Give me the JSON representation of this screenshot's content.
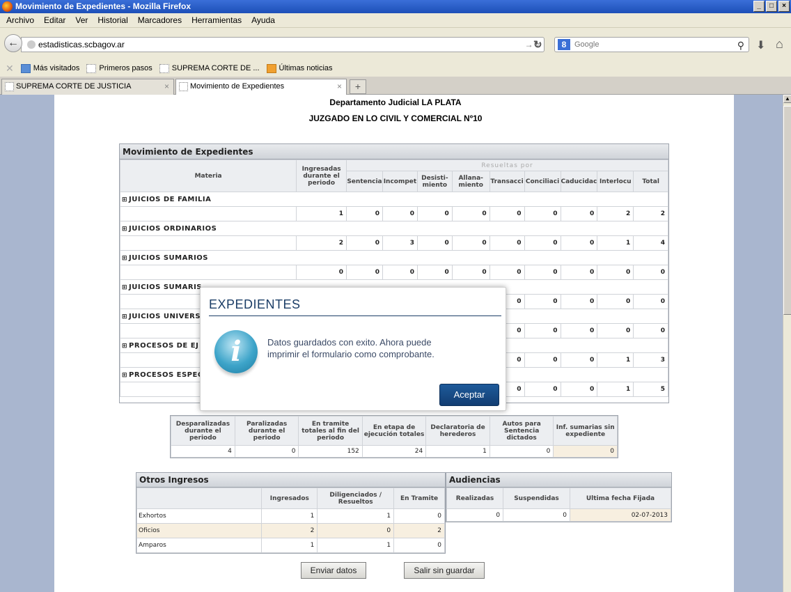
{
  "window": {
    "title": "Movimiento de Expedientes - Mozilla Firefox",
    "controls": [
      "_",
      "□",
      "×"
    ]
  },
  "menu": [
    "Archivo",
    "Editar",
    "Ver",
    "Historial",
    "Marcadores",
    "Herramientas",
    "Ayuda"
  ],
  "nav": {
    "url": "estadisticas.scbagov.ar",
    "search_placeholder": "Google"
  },
  "bookmarks": [
    "Más visitados",
    "Primeros pasos",
    "SUPREMA CORTE DE ...",
    "Últimas noticias"
  ],
  "tabs": [
    "SUPREMA CORTE DE JUSTICIA",
    "Movimiento de Expedientes"
  ],
  "page": {
    "dept": "Departamento Judicial LA PLATA",
    "court": "JUZGADO EN LO CIVIL Y COMERCIAL Nº10"
  },
  "movimiento": {
    "title": "Movimiento de Expedientes",
    "col_materia": "Materia",
    "col_ingresadas": "Ingresadas durante el periodo",
    "col_resueltas": "Resueltas por",
    "cols": [
      "Sentencia",
      "Incompet",
      "Desisti-miento",
      "Allana-miento",
      "Transacci",
      "Conciliaci",
      "Caducidac",
      "Interlocu",
      "Total"
    ],
    "groups": [
      {
        "name": "JUICIOS DE FAMILIA",
        "values": [
          "1",
          "0",
          "0",
          "0",
          "0",
          "0",
          "0",
          "0",
          "2",
          "2"
        ]
      },
      {
        "name": "JUICIOS ORDINARIOS",
        "values": [
          "2",
          "0",
          "3",
          "0",
          "0",
          "0",
          "0",
          "0",
          "1",
          "4"
        ]
      },
      {
        "name": "JUICIOS SUMARIOS",
        "values": [
          "0",
          "0",
          "0",
          "0",
          "0",
          "0",
          "0",
          "0",
          "0",
          "0"
        ]
      },
      {
        "name": "JUICIOS SUMARIS",
        "values": [
          "",
          "",
          "",
          "",
          "",
          "0",
          "0",
          "0",
          "0",
          "0"
        ]
      },
      {
        "name": "JUICIOS UNIVERS",
        "values": [
          "",
          "",
          "",
          "",
          "",
          "0",
          "0",
          "0",
          "0",
          "0"
        ]
      },
      {
        "name": "PROCESOS DE EJ",
        "values": [
          "",
          "",
          "",
          "",
          "",
          "0",
          "0",
          "0",
          "1",
          "3"
        ]
      },
      {
        "name": "PROCESOS ESPEC",
        "values": [
          "",
          "",
          "",
          "",
          "",
          "0",
          "0",
          "0",
          "1",
          "5"
        ]
      }
    ]
  },
  "stats": {
    "headers": [
      "Desparalizadas durante el periodo",
      "Paralizadas durante el periodo",
      "En tramite totales al fin del periodo",
      "En etapa de ejecución totales",
      "Declaratoria de herederos",
      "Autos para Sentencia dictados",
      "Inf. sumarias sin expediente"
    ],
    "values": [
      "4",
      "0",
      "152",
      "24",
      "1",
      "0",
      "0"
    ]
  },
  "otros": {
    "title": "Otros Ingresos",
    "headers": [
      "Ingresados",
      "Diligenciados / Resueltos",
      "En Tramite"
    ],
    "rows": [
      {
        "label": "Exhortos",
        "values": [
          "1",
          "1",
          "0"
        ]
      },
      {
        "label": "Oficios",
        "values": [
          "2",
          "0",
          "2"
        ]
      },
      {
        "label": "Amparos",
        "values": [
          "1",
          "1",
          "0"
        ]
      }
    ]
  },
  "audiencias": {
    "title": "Audiencias",
    "headers": [
      "Realizadas",
      "Suspendidas",
      "Ultima fecha Fijada"
    ],
    "values": [
      "0",
      "0",
      "02-07-2013"
    ]
  },
  "buttons": {
    "enviar": "Enviar datos",
    "salir": "Salir sin guardar"
  },
  "dialog": {
    "title": "EXPEDIENTES",
    "message_line1": "Datos guardados con exito. Ahora puede",
    "message_line2": "imprimir el formulario como comprobante.",
    "ok": "Aceptar"
  }
}
